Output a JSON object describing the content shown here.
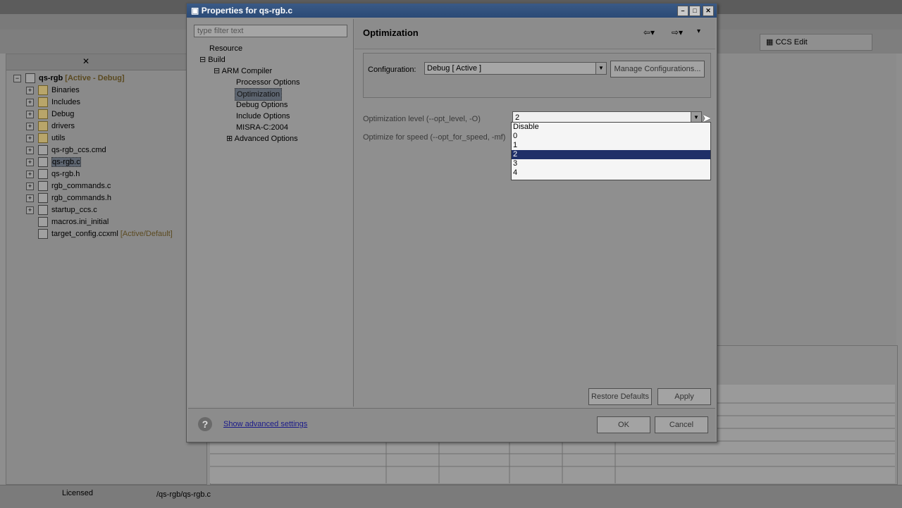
{
  "ide": {
    "project_tree": [
      {
        "label": "qs-rgb",
        "suffix": "[Active - Debug]",
        "kind": "project"
      },
      {
        "label": "Binaries",
        "kind": "folder"
      },
      {
        "label": "Includes",
        "kind": "folder"
      },
      {
        "label": "Debug",
        "kind": "folder"
      },
      {
        "label": "drivers",
        "kind": "folder"
      },
      {
        "label": "utils",
        "kind": "folder"
      },
      {
        "label": "qs-rgb_ccs.cmd",
        "kind": "file"
      },
      {
        "label": "qs-rgb.c",
        "kind": "file"
      },
      {
        "label": "qs-rgb.h",
        "kind": "file"
      },
      {
        "label": "rgb_commands.c",
        "kind": "file"
      },
      {
        "label": "rgb_commands.h",
        "kind": "file"
      },
      {
        "label": "startup_ccs.c",
        "kind": "file"
      },
      {
        "label": "macros.ini_initial",
        "kind": "file"
      },
      {
        "label": "target_config.ccxml",
        "suffix": "[Active/Default]",
        "kind": "file"
      }
    ],
    "perspective_label": "CCS Edit",
    "status": {
      "licensed": "Licensed",
      "path": "/qs-rgb/qs-rgb.c"
    }
  },
  "dialog": {
    "title": "Properties for qs-rgb.c",
    "filter_placeholder": "type filter text",
    "nav": {
      "resource": "Resource",
      "build": "Build",
      "arm_compiler": "ARM Compiler",
      "processor_options": "Processor Options",
      "optimization": "Optimization",
      "debug_options": "Debug Options",
      "include_options": "Include Options",
      "misra": "MISRA-C:2004",
      "advanced_options": "Advanced Options"
    },
    "page_title": "Optimization",
    "configuration_label": "Configuration:",
    "configuration_value": "Debug  [ Active ]",
    "manage_button": "Manage Configurations...",
    "opt_level_label": "Optimization level (--opt_level, -O)",
    "opt_level_value": "2",
    "opt_speed_label": "Optimize for speed (--opt_for_speed, -mf)",
    "dropdown_options": [
      "Disable",
      "0",
      "1",
      "2",
      "3",
      "4"
    ],
    "dropdown_selected_index": 3,
    "restore_button": "Restore Defaults",
    "apply_button": "Apply",
    "advanced_link": "Show advanced settings",
    "ok_button": "OK",
    "cancel_button": "Cancel"
  }
}
